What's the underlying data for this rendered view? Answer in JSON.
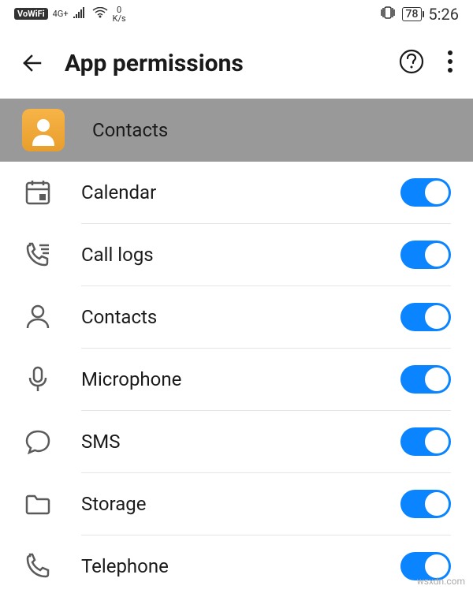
{
  "status": {
    "vowifi": "VoWiFi",
    "net": "4G+",
    "speed_num": "0",
    "speed_unit": "K/s",
    "battery": "78",
    "time": "5:26"
  },
  "header": {
    "title": "App permissions"
  },
  "app": {
    "name": "Contacts"
  },
  "permissions": [
    {
      "icon": "calendar",
      "label": "Calendar",
      "enabled": true
    },
    {
      "icon": "calllog",
      "label": "Call logs",
      "enabled": true
    },
    {
      "icon": "contacts",
      "label": "Contacts",
      "enabled": true
    },
    {
      "icon": "microphone",
      "label": "Microphone",
      "enabled": true
    },
    {
      "icon": "sms",
      "label": "SMS",
      "enabled": true
    },
    {
      "icon": "storage",
      "label": "Storage",
      "enabled": true
    },
    {
      "icon": "telephone",
      "label": "Telephone",
      "enabled": true
    }
  ],
  "watermark": "wsxdn.com"
}
